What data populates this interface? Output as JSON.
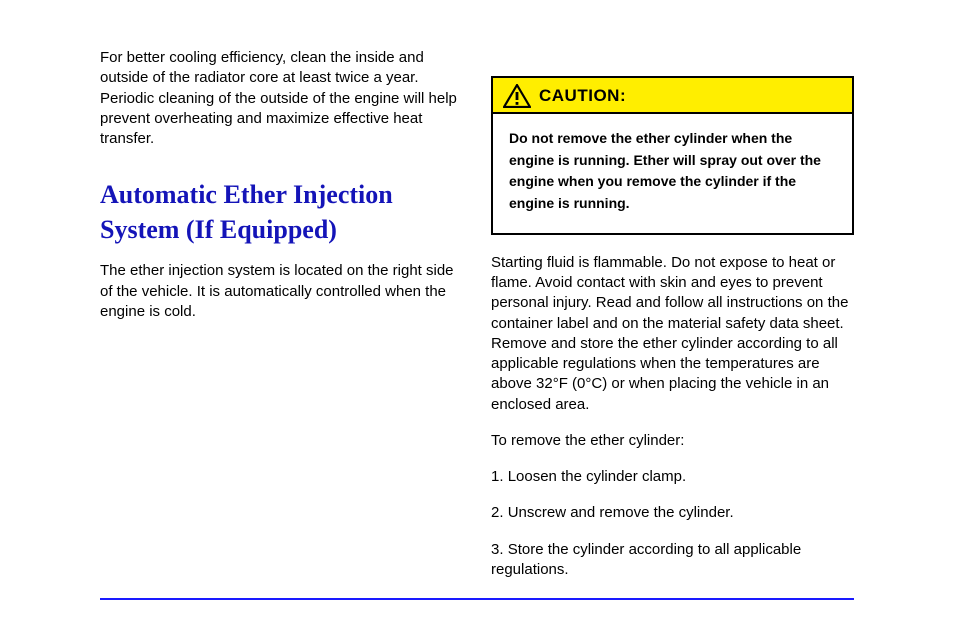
{
  "left": {
    "paragraph": "For better cooling efficiency, clean the inside and outside of the radiator core at least twice a year. Periodic cleaning of the outside of the engine will help prevent overheating and maximize effective heat transfer.",
    "heading": "Automatic Ether Injection System (If Equipped)",
    "sub": "The ether injection system is located on the right side of the vehicle. It is automatically controlled when the engine is cold."
  },
  "caution": {
    "label": "CAUTION:",
    "body": "Do not remove the ether cylinder when the engine is running. Ether will spray out over the engine when you remove the cylinder if the engine is running."
  },
  "right_after": "Starting fluid is flammable. Do not expose to heat or flame. Avoid contact with skin and eyes to prevent personal injury. Read and follow all instructions on the container label and on the material safety data sheet. Remove and store the ether cylinder according to all applicable regulations when the temperatures are above 32°F (0°C) or when placing the vehicle in an enclosed area.",
  "remove_heading": "To remove the ether cylinder:",
  "remove_steps": [
    "Loosen the cylinder clamp.",
    "Unscrew and remove the cylinder.",
    "Store the cylinder according to all applicable regulations."
  ]
}
